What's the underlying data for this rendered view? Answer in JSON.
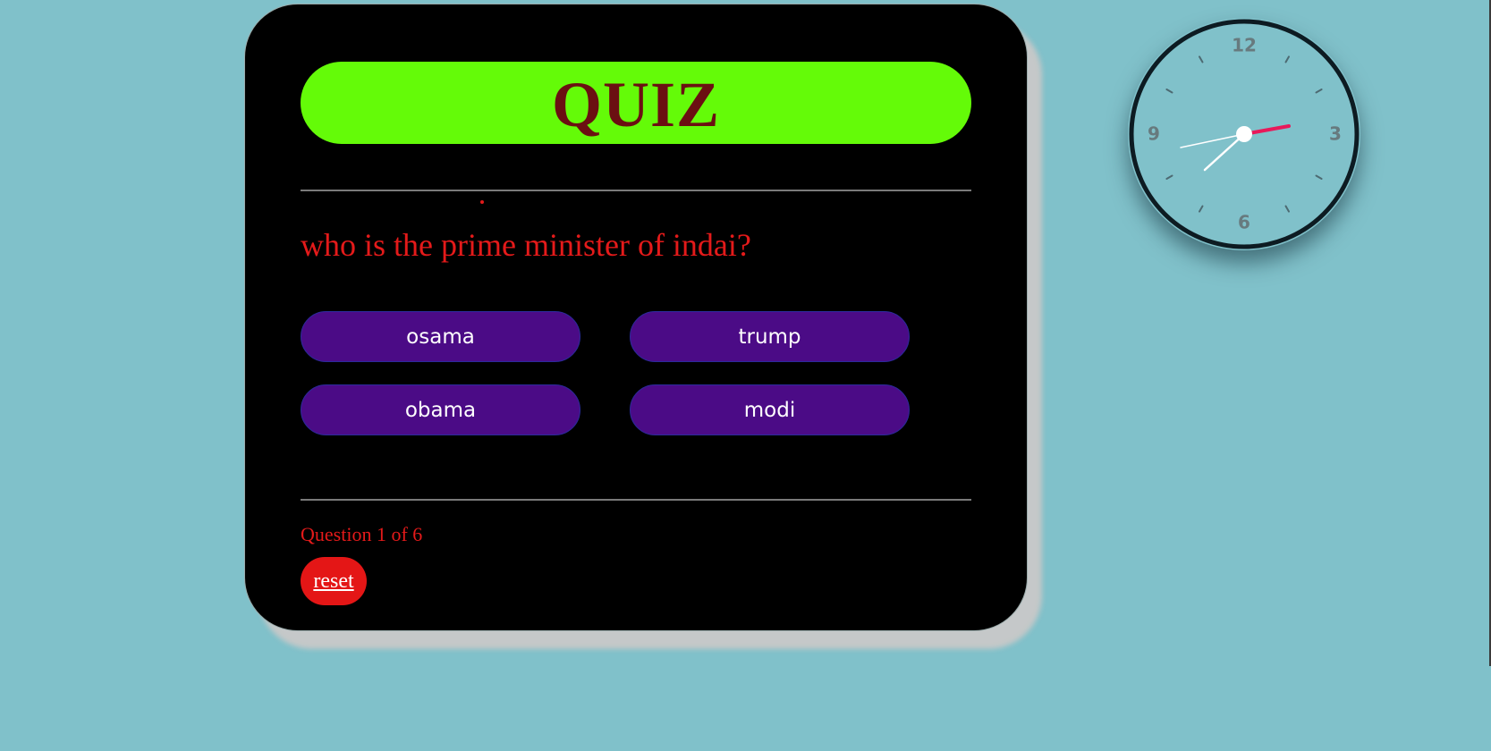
{
  "quiz": {
    "title": "QUIZ",
    "question": "who is the prime minister of indai?",
    "answers": [
      {
        "label": "osama"
      },
      {
        "label": "trump"
      },
      {
        "label": "obama"
      },
      {
        "label": "modi"
      }
    ],
    "progress": "Question 1 of 6",
    "reset_label": "reset"
  },
  "clock": {
    "numerals": [
      "12",
      "3",
      "6",
      "9"
    ]
  },
  "colors": {
    "background": "#80c1ca",
    "card": "#000000",
    "banner": "#64fb08",
    "title": "#6b0f12",
    "question": "#e41a1a",
    "answer_button": "#4b0b86",
    "reset_button": "#e41616",
    "clock_face": "#80c1ca",
    "clock_rim": "#0d1b22",
    "second_hand": "#e8195a"
  }
}
